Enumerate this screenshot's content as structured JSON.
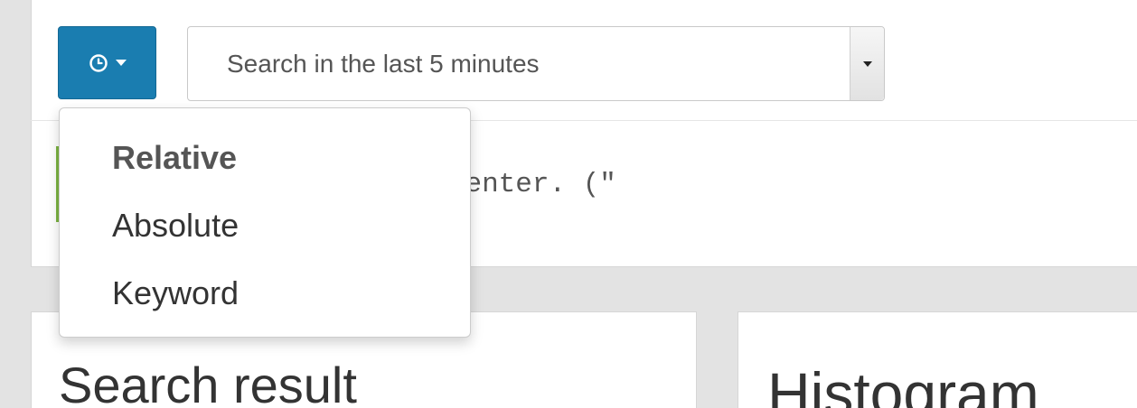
{
  "toolbar": {
    "time_menu_icon": "clock-icon",
    "time_menu_caret": "caret-down-icon",
    "range_value": "Search in the last 5 minutes"
  },
  "query": {
    "visible_text": "ch query here and press enter. (\""
  },
  "dropdown": {
    "items": [
      {
        "label": "Relative",
        "selected": true
      },
      {
        "label": "Absolute",
        "selected": false
      },
      {
        "label": "Keyword",
        "selected": false
      }
    ]
  },
  "panels": {
    "left_title": "Search result",
    "right_title": "Histogram"
  },
  "colors": {
    "primary": "#1a7db0",
    "accent_green": "#7cb342",
    "background": "#e3e3e3"
  }
}
